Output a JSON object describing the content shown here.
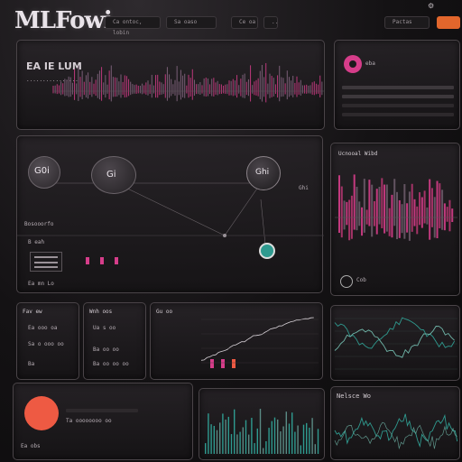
{
  "header": {
    "brand": "MLFowi",
    "tabs": [
      "Ca ontoc, lobin",
      "Sa  oaso",
      "Ce oa",
      "..",
      "Pactas"
    ],
    "action_button": "",
    "settings_icon": "gear-icon"
  },
  "top_panel": {
    "title": "EA IE LUM",
    "subtitle": "................"
  },
  "user_panel": {
    "avatar_icon": "record-icon",
    "label": "eba"
  },
  "mid_panel": {
    "top_label": "",
    "node_a_label": "G0i",
    "node_b_label": "Gi",
    "node_c_label": "Ghi",
    "node_c_side": "Ghi",
    "section_label": "Bosooorfo",
    "legend_label": "B eah",
    "bottom_label": "Ea mn Lo"
  },
  "right_chart_panel": {
    "title": "Ucnooal Wibd",
    "footer_label": "Cob"
  },
  "stat_panel_1": {
    "title": "Fav ew",
    "rows": [
      "Ea ooo oa",
      "Sa o ooo oo",
      "Ba"
    ]
  },
  "stat_panel_2": {
    "title": "Wnh oos",
    "rows": [
      "Ua s oo",
      "Ba oo oo",
      "Ba oo oo oo"
    ]
  },
  "stat_panel_3": {
    "title": "Gu oo"
  },
  "bottom_left_panel": {
    "label": "Ea obs",
    "line": "Ta oooooooo oo"
  },
  "bottom_right_panel": {
    "title": "Nelsce Wo"
  },
  "colors": {
    "accent_orange": "#e2662c",
    "accent_pink": "#d63d8a",
    "accent_teal": "#2f9a8f",
    "coral": "#ee5a43"
  }
}
